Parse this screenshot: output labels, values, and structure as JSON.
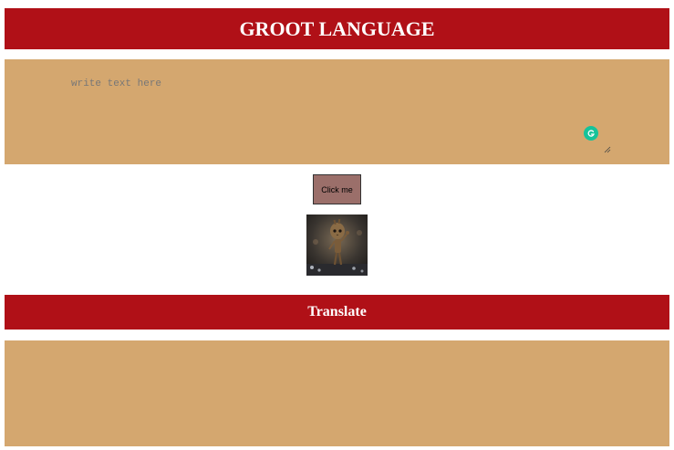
{
  "header": {
    "title": "GROOT LANGUAGE"
  },
  "input": {
    "placeholder": "write text here",
    "value": ""
  },
  "button": {
    "label": "Click me"
  },
  "image": {
    "alt": "Baby Groot waving"
  },
  "translate": {
    "label": "Translate"
  },
  "output": {
    "text": ""
  },
  "colors": {
    "header_bg": "#b01017",
    "panel_bg": "#d4a76f",
    "button_bg": "#9b6f6a",
    "grammarly": "#15c39a"
  },
  "icons": {
    "grammarly": "grammarly-icon",
    "resize": "resize-handle-icon"
  }
}
